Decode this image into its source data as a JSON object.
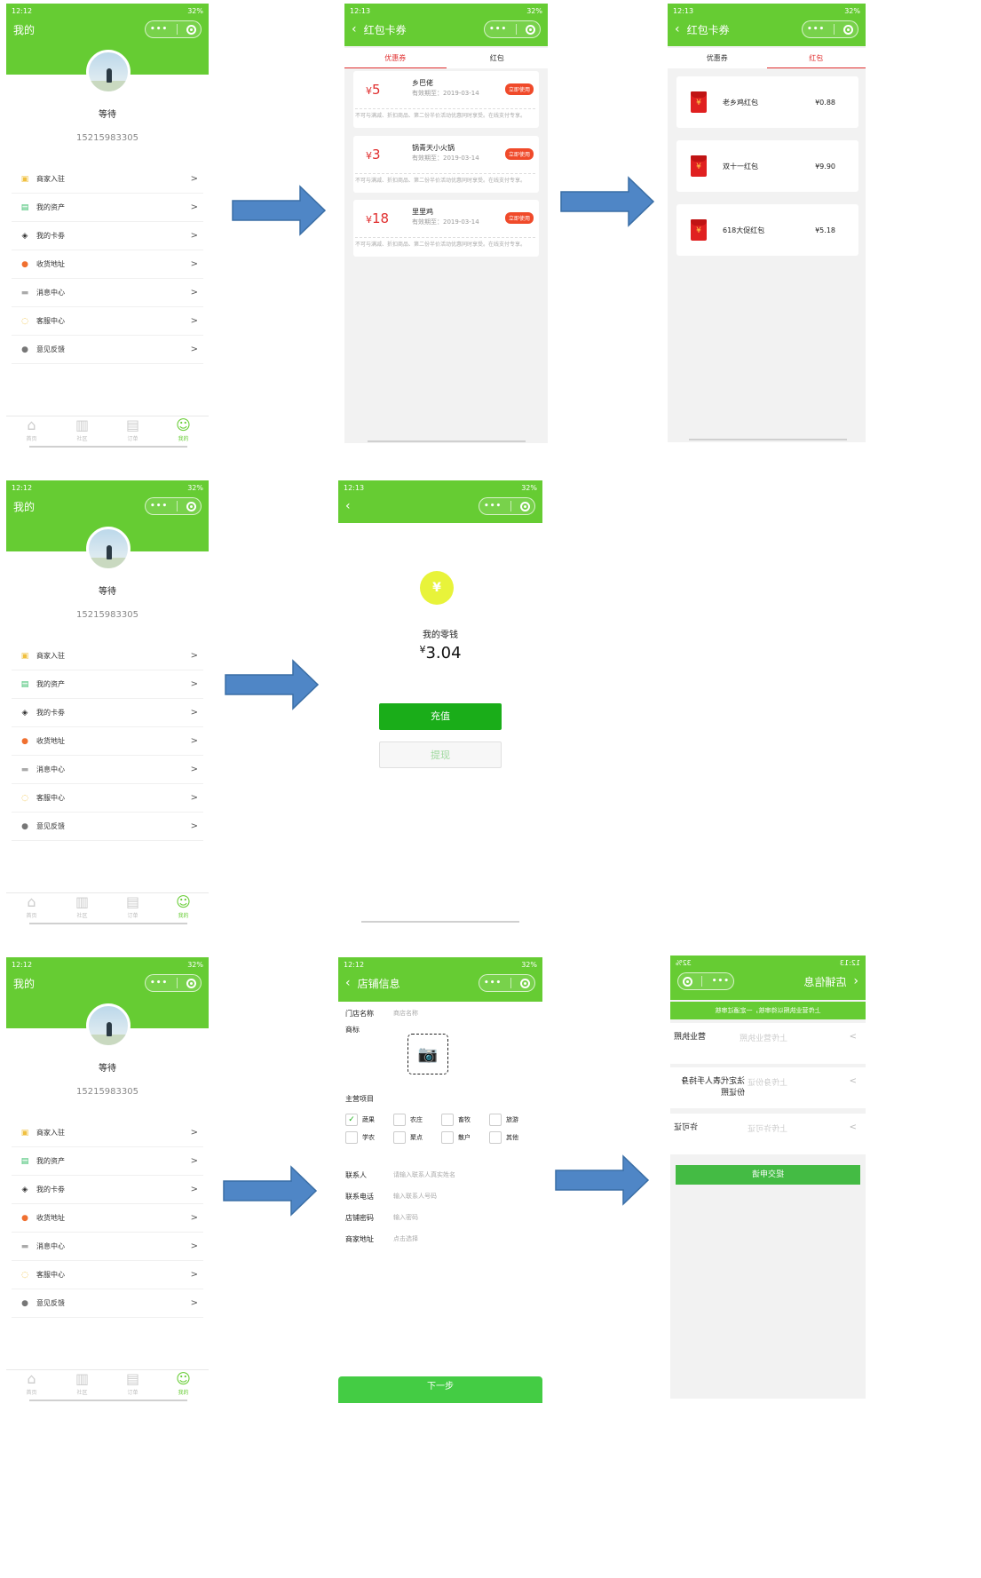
{
  "common": {
    "status_time_1": "12:12",
    "status_time_2": "12:13",
    "status_right": "32%",
    "capsule_dots": "•••"
  },
  "profile": {
    "title": "我的",
    "username": "等待",
    "phone": "15215983305",
    "menu": [
      {
        "label": "商家入驻",
        "icon": "store-icon",
        "glyph": "▣",
        "color": "#f0c040"
      },
      {
        "label": "我的资产",
        "icon": "wallet-icon",
        "glyph": "▤",
        "color": "#33bb66"
      },
      {
        "label": "我的卡劵",
        "icon": "ticket-icon",
        "glyph": "◈",
        "color": "#333333"
      },
      {
        "label": "收货地址",
        "icon": "location-icon",
        "glyph": "●",
        "color": "#f07030"
      },
      {
        "label": "消息中心",
        "icon": "message-icon",
        "glyph": "▬",
        "color": "#aaaaaa"
      },
      {
        "label": "客服中心",
        "icon": "service-icon",
        "glyph": "◌",
        "color": "#f0c040"
      },
      {
        "label": "意见反馈",
        "icon": "info-icon",
        "glyph": "●",
        "color": "#777777"
      }
    ],
    "tabs": [
      {
        "label": "首页",
        "glyph": "⌂"
      },
      {
        "label": "社区",
        "glyph": "▥"
      },
      {
        "label": "订单",
        "glyph": "▤"
      },
      {
        "label": "我的",
        "glyph": "☺"
      }
    ]
  },
  "cards": {
    "title": "红包卡券",
    "tab_coupon": "优惠券",
    "tab_redpacket": "红包",
    "coupons": [
      {
        "amount": "5",
        "name": "乡巴佬",
        "date": "有效期至：2019-03-14",
        "use": "立即使用",
        "desc": "不可与满减、折扣商品、第二份半价活动优惠同时享受。在线支付专享。"
      },
      {
        "amount": "3",
        "name": "锅青天小火锅",
        "date": "有效期至：2019-03-14",
        "use": "立即使用",
        "desc": "不可与满减、折扣商品、第二份半价活动优惠同时享受。在线支付专享。"
      },
      {
        "amount": "18",
        "name": "里里鸡",
        "date": "有效期至：2019-03-14",
        "use": "立即使用",
        "desc": "不可与满减、折扣商品、第二份半价活动优惠同时享受。在线支付专享。"
      }
    ],
    "redpackets": [
      {
        "name": "老乡鸡红包",
        "value": "¥0.88"
      },
      {
        "name": "双十一红包",
        "value": "¥9.90"
      },
      {
        "name": "618大促红包",
        "value": "¥5.18"
      }
    ],
    "currency": "¥"
  },
  "wallet": {
    "label": "我的零钱",
    "currency": "¥",
    "amount": "3.04",
    "recharge": "充值",
    "withdraw": "提现",
    "icon_glyph": "¥"
  },
  "shop": {
    "title": "店铺信息",
    "store_name_label": "门店名称",
    "store_name_placeholder": "商店名称",
    "logo_label": "商标",
    "main_label": "主营项目",
    "items": [
      "蔬果",
      "农庄",
      "畜牧",
      "旅游",
      "学农",
      "聚点",
      "散户",
      "其他"
    ],
    "contact_label": "联系人",
    "contact_placeholder": "请输入联系人真实姓名",
    "phone_label": "联系电话",
    "phone_placeholder": "输入联系人号码",
    "password_label": "店铺密码",
    "password_placeholder": "输入密码",
    "address_label": "商家地址",
    "address_placeholder": "点击选择",
    "next": "下一步"
  },
  "license": {
    "title": "店铺信息",
    "banner": "上传营业执照以待审核，一定通过审核",
    "rows": [
      {
        "label": "营业执照",
        "upload": "上传营业执照"
      },
      {
        "label": "法定代表人手持身份证照",
        "upload": "上传身份证"
      },
      {
        "label": "许可证",
        "upload": "上传许可证"
      }
    ],
    "submit": "提交申请"
  },
  "colors": {
    "brand_green": "#66cc33",
    "button_green": "#1aad19",
    "red": "#e02e2e",
    "arrow_blue": "#4f86c6"
  }
}
